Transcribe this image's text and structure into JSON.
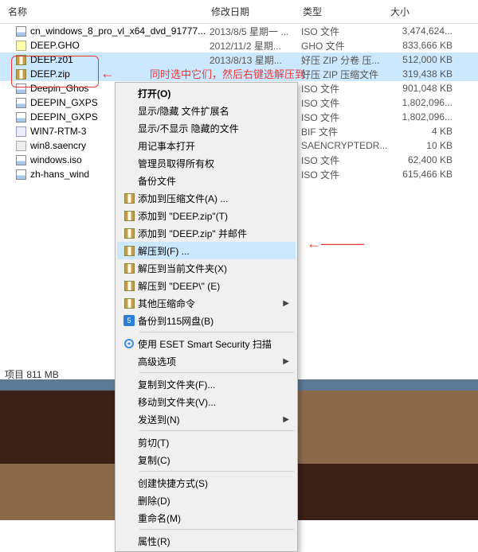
{
  "columns": {
    "name": "名称",
    "date": "修改日期",
    "type": "类型",
    "size": "大小"
  },
  "files": [
    {
      "icon": "iso",
      "name": "cn_windows_8_pro_vl_x64_dvd_91777...",
      "date": "2013/8/5 星期一 ...",
      "type": "ISO 文件",
      "size": "3,474,624...",
      "sel": false
    },
    {
      "icon": "gho",
      "name": "DEEP.GHO",
      "date": "2012/11/2 星期...",
      "type": "GHO 文件",
      "size": "833,666 KB",
      "sel": false
    },
    {
      "icon": "zip",
      "name": "DEEP.z01",
      "date": "2013/8/13 星期...",
      "type": "好压 ZIP 分卷 压...",
      "size": "512,000 KB",
      "sel": true
    },
    {
      "icon": "zip",
      "name": "DEEP.zip",
      "date": "",
      "type": "好压 ZIP 压缩文件",
      "size": "319,438 KB",
      "sel": true
    },
    {
      "icon": "iso",
      "name": "Deepin_Ghos",
      "date": "",
      "type": "ISO 文件",
      "size": "901,048 KB",
      "sel": false
    },
    {
      "icon": "iso",
      "name": "DEEPIN_GXPS",
      "date": "",
      "type": "ISO 文件",
      "size": "1,802,096...",
      "sel": false
    },
    {
      "icon": "iso",
      "name": "DEEPIN_GXPS",
      "date": "",
      "type": "ISO 文件",
      "size": "1,802,096...",
      "sel": false
    },
    {
      "icon": "bif",
      "name": "WIN7-RTM-3",
      "date": "",
      "type": "BIF 文件",
      "size": "4 KB",
      "sel": false
    },
    {
      "icon": "enc",
      "name": "win8.saencry",
      "date": "",
      "type": "SAENCRYPTEDR...",
      "size": "10 KB",
      "sel": false
    },
    {
      "icon": "iso",
      "name": "windows.iso",
      "date": "",
      "type": "ISO 文件",
      "size": "62,400 KB",
      "sel": false
    },
    {
      "icon": "iso",
      "name": "zh-hans_wind",
      "date": "",
      "type": "ISO 文件",
      "size": "615,466 KB",
      "sel": false
    }
  ],
  "menu": {
    "open": "打开(O)",
    "showhide_ext": "显示/隐藏 文件扩展名",
    "showhide_hidden": "显示/不显示 隐藏的文件",
    "notepad": "用记事本打开",
    "take_ownership": "管理员取得所有权",
    "backup": "备份文件",
    "add_archive": "添加到压缩文件(A) ...",
    "add_deepzip": "添加到 \"DEEP.zip\"(T)",
    "add_deepzip_mail": "添加到 \"DEEP.zip\" 并邮件",
    "extract_to": "解压到(F) ...",
    "extract_here": "解压到当前文件夹(X)",
    "extract_deep": "解压到 \"DEEP\\\" (E)",
    "other_compress": "其他压缩命令",
    "backup_115": "备份到115网盘(B)",
    "eset_scan": "使用 ESET Smart Security 扫描",
    "advanced": "高级选项",
    "copy_to_folder": "复制到文件夹(F)...",
    "move_to_folder": "移动到文件夹(V)...",
    "send_to": "发送到(N)",
    "cut": "剪切(T)",
    "copy": "复制(C)",
    "create_shortcut": "创建快捷方式(S)",
    "delete": "删除(D)",
    "rename": "重命名(M)",
    "properties": "属性(R)"
  },
  "annotation": {
    "text": "同时选中它们，然后右键选解压到"
  },
  "status": "项目   811 MB"
}
